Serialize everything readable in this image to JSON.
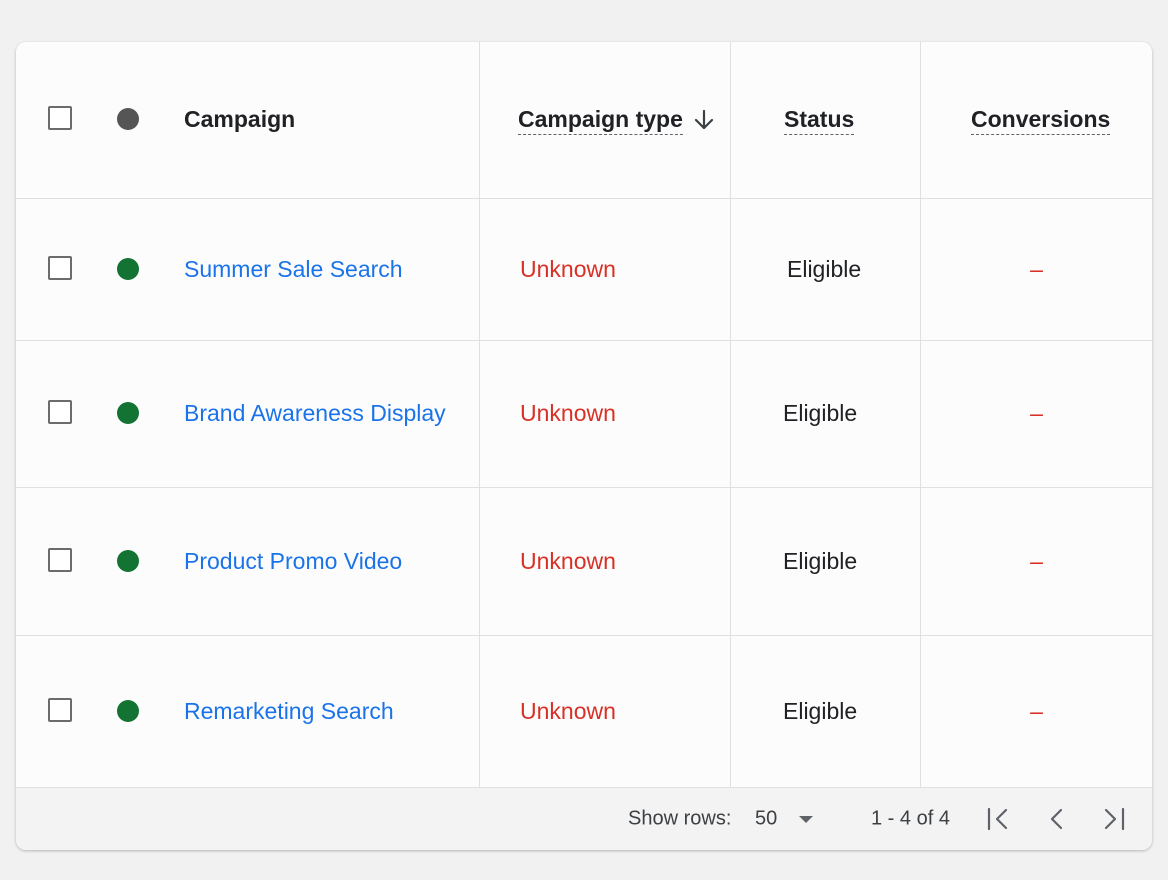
{
  "header": {
    "campaign": "Campaign",
    "campaign_type": "Campaign type",
    "status": "Status",
    "conversions": "Conversions",
    "sort_icon": "arrow-down-icon"
  },
  "rows": [
    {
      "campaign": "Summer Sale Search",
      "type": "Unknown",
      "status": "Eligible",
      "conversions": "–"
    },
    {
      "campaign": "Brand Awareness Display",
      "type": "Unknown",
      "status": "Eligible",
      "conversions": "–"
    },
    {
      "campaign": "Product Promo Video",
      "type": "Unknown",
      "status": "Eligible",
      "conversions": "–"
    },
    {
      "campaign": "Remarketing Search",
      "type": "Unknown",
      "status": "Eligible",
      "conversions": "–"
    }
  ],
  "footer": {
    "show_rows_label": "Show rows:",
    "rows_value": "50",
    "range": "1 - 4 of 4",
    "icons": [
      "dropdown-arrow-icon",
      "first-page-icon",
      "previous-page-icon",
      "last-page-icon"
    ]
  },
  "colors": {
    "link": "#1a73e8",
    "error": "#d93025",
    "status_dot": "#137333",
    "header_dot": "#555555"
  }
}
